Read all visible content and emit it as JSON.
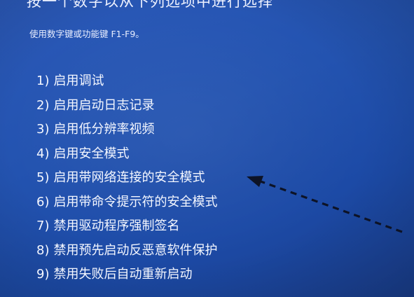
{
  "header": {
    "title": "按一个数字以从下列选项中进行选择"
  },
  "hint": {
    "text": "使用数字键或功能键 F1-F9。"
  },
  "options": [
    {
      "number": "1)",
      "label": "启用调试"
    },
    {
      "number": "2)",
      "label": "启用启动日志记录"
    },
    {
      "number": "3)",
      "label": "启用低分辨率视频"
    },
    {
      "number": "4)",
      "label": "启用安全模式"
    },
    {
      "number": "5)",
      "label": "启用带网络连接的安全模式"
    },
    {
      "number": "6)",
      "label": "启用带命令提示符的安全模式"
    },
    {
      "number": "7)",
      "label": "禁用驱动程序强制签名"
    },
    {
      "number": "8)",
      "label": "禁用预先启动反恶意软件保护"
    },
    {
      "number": "9)",
      "label": "禁用失败后自动重新启动"
    }
  ],
  "annotation": {
    "icon": "dashed-arrow-icon",
    "points_to_option": 5,
    "color": "#0d1326"
  },
  "colors": {
    "background": "#2353b0",
    "text": "#f2f4ff"
  }
}
